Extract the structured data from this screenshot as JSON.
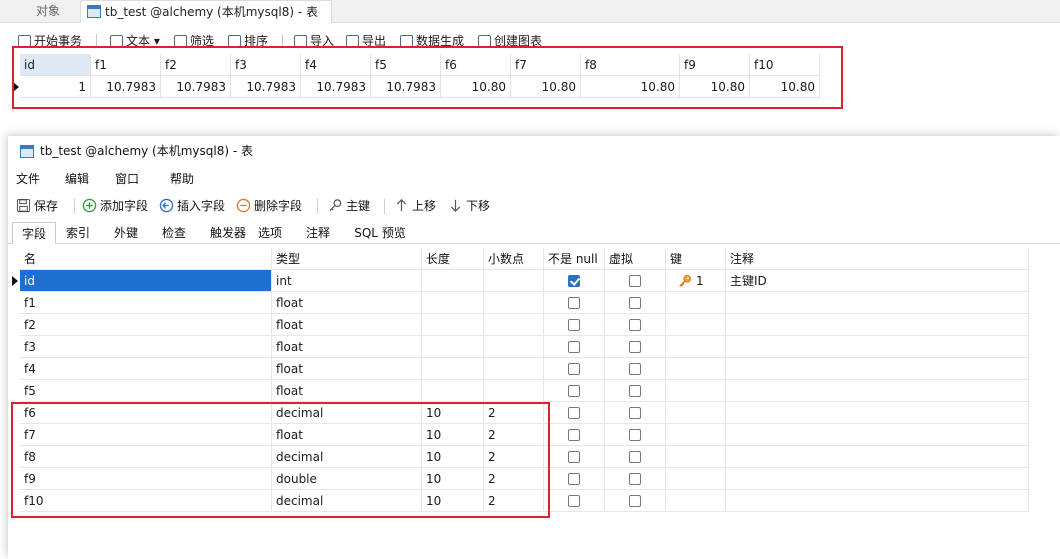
{
  "bg_window": {
    "tabs": [
      "对象",
      "tb_test @alchemy (本机mysql8) - 表"
    ],
    "toolbar": [
      "开始事务",
      "文本",
      "筛选",
      "排序",
      "导入",
      "导出",
      "数据生成",
      "创建图表"
    ],
    "grid": {
      "columns": [
        "id",
        "f1",
        "f2",
        "f3",
        "f4",
        "f5",
        "f6",
        "f7",
        "f8",
        "f9",
        "f10"
      ],
      "rows": [
        [
          "1",
          "10.7983",
          "10.7983",
          "10.7983",
          "10.7983",
          "10.7983",
          "10.80",
          "10.80",
          "10.80",
          "10.80",
          "10.80"
        ]
      ]
    },
    "highlight_color": "#e0202f"
  },
  "fg_window": {
    "title": "tb_test @alchemy (本机mysql8) - 表",
    "menu": [
      "文件",
      "编辑",
      "窗口",
      "帮助"
    ],
    "toolbar": [
      "保存",
      "添加字段",
      "插入字段",
      "删除字段",
      "主键",
      "上移",
      "下移"
    ],
    "subtabs": [
      "字段",
      "索引",
      "外键",
      "检查",
      "触发器",
      "选项",
      "注释",
      "SQL 预览"
    ],
    "active_subtab": "字段",
    "field_columns": [
      "名",
      "类型",
      "长度",
      "小数点",
      "不是 null",
      "虚拟",
      "键",
      "注释"
    ],
    "fields": [
      {
        "name": "id",
        "type": "int",
        "length": "",
        "decimals": "",
        "not_null": true,
        "virtual": false,
        "key": "1",
        "comment": "主键ID"
      },
      {
        "name": "f1",
        "type": "float",
        "length": "",
        "decimals": "",
        "not_null": false,
        "virtual": false,
        "key": "",
        "comment": ""
      },
      {
        "name": "f2",
        "type": "float",
        "length": "",
        "decimals": "",
        "not_null": false,
        "virtual": false,
        "key": "",
        "comment": ""
      },
      {
        "name": "f3",
        "type": "float",
        "length": "",
        "decimals": "",
        "not_null": false,
        "virtual": false,
        "key": "",
        "comment": ""
      },
      {
        "name": "f4",
        "type": "float",
        "length": "",
        "decimals": "",
        "not_null": false,
        "virtual": false,
        "key": "",
        "comment": ""
      },
      {
        "name": "f5",
        "type": "float",
        "length": "",
        "decimals": "",
        "not_null": false,
        "virtual": false,
        "key": "",
        "comment": ""
      },
      {
        "name": "f6",
        "type": "decimal",
        "length": "10",
        "decimals": "2",
        "not_null": false,
        "virtual": false,
        "key": "",
        "comment": ""
      },
      {
        "name": "f7",
        "type": "float",
        "length": "10",
        "decimals": "2",
        "not_null": false,
        "virtual": false,
        "key": "",
        "comment": ""
      },
      {
        "name": "f8",
        "type": "decimal",
        "length": "10",
        "decimals": "2",
        "not_null": false,
        "virtual": false,
        "key": "",
        "comment": ""
      },
      {
        "name": "f9",
        "type": "double",
        "length": "10",
        "decimals": "2",
        "not_null": false,
        "virtual": false,
        "key": "",
        "comment": ""
      },
      {
        "name": "f10",
        "type": "decimal",
        "length": "10",
        "decimals": "2",
        "not_null": false,
        "virtual": false,
        "key": "",
        "comment": ""
      }
    ],
    "selection_color": "#1e6fd0",
    "icons": [
      "save-icon",
      "add-field-icon",
      "insert-field-icon",
      "delete-field-icon",
      "primary-key-icon",
      "move-up-icon",
      "move-down-icon",
      "key-icon"
    ]
  }
}
